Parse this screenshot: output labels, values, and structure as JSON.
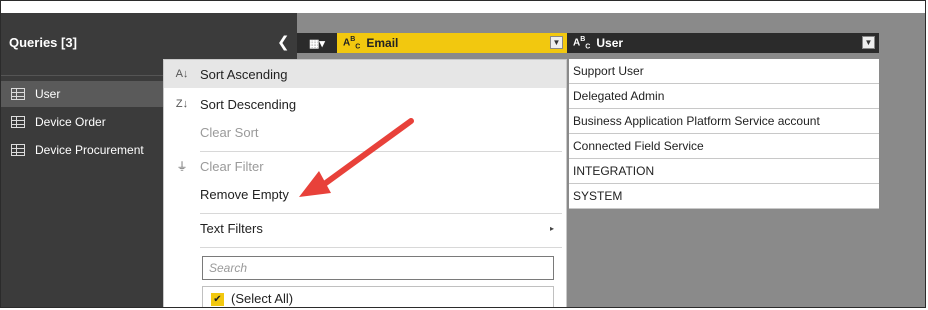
{
  "sidebar": {
    "title": "Queries [3]",
    "collapse_icon": "chevron-left-icon",
    "items": [
      {
        "label": "User",
        "icon": "table-icon",
        "selected": true
      },
      {
        "label": "Device Order",
        "icon": "table-icon",
        "selected": false
      },
      {
        "label": "Device Procurement",
        "icon": "table-icon",
        "selected": false
      }
    ]
  },
  "columns": [
    {
      "label": "Email",
      "type_icon": "abc-icon",
      "active": true
    },
    {
      "label": "User",
      "type_icon": "abc-icon",
      "active": false
    }
  ],
  "user_values": [
    "Support User",
    "Delegated Admin",
    "Business Application Platform Service account",
    "Connected Field Service",
    "INTEGRATION",
    "SYSTEM"
  ],
  "menu": {
    "sort_asc": "Sort Ascending",
    "sort_desc": "Sort Descending",
    "clear_sort": "Clear Sort",
    "clear_filter": "Clear Filter",
    "remove_empty": "Remove Empty",
    "text_filters": "Text Filters",
    "search_placeholder": "Search",
    "select_all": "(Select All)"
  },
  "colors": {
    "accent": "#f2c80f",
    "arrow": "#e8413a",
    "sidebar_bg": "#3b3b3b"
  }
}
